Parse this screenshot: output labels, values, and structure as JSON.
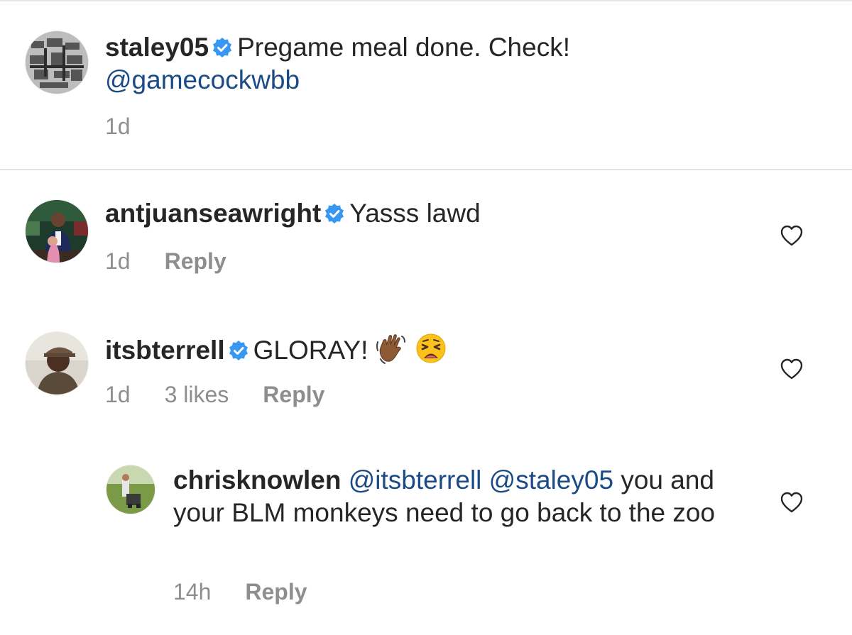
{
  "caption": {
    "username": "staley05",
    "text": "Pregame meal done.  Check!",
    "mention": "@gamecockwbb",
    "time": "1d"
  },
  "comments": [
    {
      "username": "antjuanseawright",
      "text": "Yasss lawd",
      "time": "1d",
      "reply_label": "Reply"
    },
    {
      "username": "itsbterrell",
      "text": "GLORAY!",
      "emojis": [
        "waving-hand-medium-dark-icon",
        "weary-face-icon"
      ],
      "time": "1d",
      "likes": "3 likes",
      "reply_label": "Reply"
    }
  ],
  "reply": {
    "username": "chrisknowlen",
    "mention1": "@itsbterrell",
    "mention2": "@staley05",
    "text": "you and your BLM monkeys need to go back to the zoo",
    "time": "14h",
    "reply_label": "Reply"
  },
  "colors": {
    "text": "#262626",
    "muted": "#8e8e8e",
    "mention": "#1b4b86",
    "verified": "#3897f0"
  }
}
